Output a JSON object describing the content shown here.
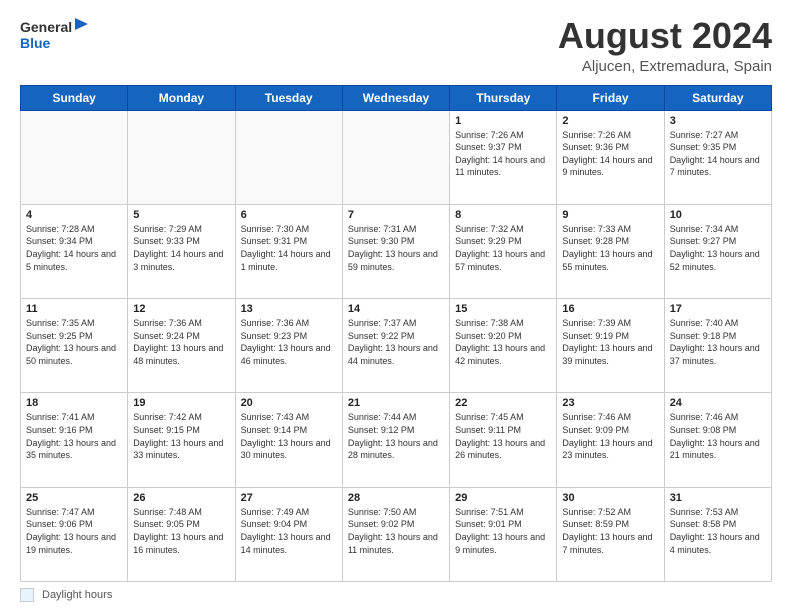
{
  "logo": {
    "line1": "General",
    "line2": "Blue"
  },
  "header": {
    "title": "August 2024",
    "location": "Aljucen, Extremadura, Spain"
  },
  "days_of_week": [
    "Sunday",
    "Monday",
    "Tuesday",
    "Wednesday",
    "Thursday",
    "Friday",
    "Saturday"
  ],
  "weeks": [
    [
      {
        "day": "",
        "info": ""
      },
      {
        "day": "",
        "info": ""
      },
      {
        "day": "",
        "info": ""
      },
      {
        "day": "",
        "info": ""
      },
      {
        "day": "1",
        "info": "Sunrise: 7:26 AM\nSunset: 9:37 PM\nDaylight: 14 hours and 11 minutes."
      },
      {
        "day": "2",
        "info": "Sunrise: 7:26 AM\nSunset: 9:36 PM\nDaylight: 14 hours and 9 minutes."
      },
      {
        "day": "3",
        "info": "Sunrise: 7:27 AM\nSunset: 9:35 PM\nDaylight: 14 hours and 7 minutes."
      }
    ],
    [
      {
        "day": "4",
        "info": "Sunrise: 7:28 AM\nSunset: 9:34 PM\nDaylight: 14 hours and 5 minutes."
      },
      {
        "day": "5",
        "info": "Sunrise: 7:29 AM\nSunset: 9:33 PM\nDaylight: 14 hours and 3 minutes."
      },
      {
        "day": "6",
        "info": "Sunrise: 7:30 AM\nSunset: 9:31 PM\nDaylight: 14 hours and 1 minute."
      },
      {
        "day": "7",
        "info": "Sunrise: 7:31 AM\nSunset: 9:30 PM\nDaylight: 13 hours and 59 minutes."
      },
      {
        "day": "8",
        "info": "Sunrise: 7:32 AM\nSunset: 9:29 PM\nDaylight: 13 hours and 57 minutes."
      },
      {
        "day": "9",
        "info": "Sunrise: 7:33 AM\nSunset: 9:28 PM\nDaylight: 13 hours and 55 minutes."
      },
      {
        "day": "10",
        "info": "Sunrise: 7:34 AM\nSunset: 9:27 PM\nDaylight: 13 hours and 52 minutes."
      }
    ],
    [
      {
        "day": "11",
        "info": "Sunrise: 7:35 AM\nSunset: 9:25 PM\nDaylight: 13 hours and 50 minutes."
      },
      {
        "day": "12",
        "info": "Sunrise: 7:36 AM\nSunset: 9:24 PM\nDaylight: 13 hours and 48 minutes."
      },
      {
        "day": "13",
        "info": "Sunrise: 7:36 AM\nSunset: 9:23 PM\nDaylight: 13 hours and 46 minutes."
      },
      {
        "day": "14",
        "info": "Sunrise: 7:37 AM\nSunset: 9:22 PM\nDaylight: 13 hours and 44 minutes."
      },
      {
        "day": "15",
        "info": "Sunrise: 7:38 AM\nSunset: 9:20 PM\nDaylight: 13 hours and 42 minutes."
      },
      {
        "day": "16",
        "info": "Sunrise: 7:39 AM\nSunset: 9:19 PM\nDaylight: 13 hours and 39 minutes."
      },
      {
        "day": "17",
        "info": "Sunrise: 7:40 AM\nSunset: 9:18 PM\nDaylight: 13 hours and 37 minutes."
      }
    ],
    [
      {
        "day": "18",
        "info": "Sunrise: 7:41 AM\nSunset: 9:16 PM\nDaylight: 13 hours and 35 minutes."
      },
      {
        "day": "19",
        "info": "Sunrise: 7:42 AM\nSunset: 9:15 PM\nDaylight: 13 hours and 33 minutes."
      },
      {
        "day": "20",
        "info": "Sunrise: 7:43 AM\nSunset: 9:14 PM\nDaylight: 13 hours and 30 minutes."
      },
      {
        "day": "21",
        "info": "Sunrise: 7:44 AM\nSunset: 9:12 PM\nDaylight: 13 hours and 28 minutes."
      },
      {
        "day": "22",
        "info": "Sunrise: 7:45 AM\nSunset: 9:11 PM\nDaylight: 13 hours and 26 minutes."
      },
      {
        "day": "23",
        "info": "Sunrise: 7:46 AM\nSunset: 9:09 PM\nDaylight: 13 hours and 23 minutes."
      },
      {
        "day": "24",
        "info": "Sunrise: 7:46 AM\nSunset: 9:08 PM\nDaylight: 13 hours and 21 minutes."
      }
    ],
    [
      {
        "day": "25",
        "info": "Sunrise: 7:47 AM\nSunset: 9:06 PM\nDaylight: 13 hours and 19 minutes."
      },
      {
        "day": "26",
        "info": "Sunrise: 7:48 AM\nSunset: 9:05 PM\nDaylight: 13 hours and 16 minutes."
      },
      {
        "day": "27",
        "info": "Sunrise: 7:49 AM\nSunset: 9:04 PM\nDaylight: 13 hours and 14 minutes."
      },
      {
        "day": "28",
        "info": "Sunrise: 7:50 AM\nSunset: 9:02 PM\nDaylight: 13 hours and 11 minutes."
      },
      {
        "day": "29",
        "info": "Sunrise: 7:51 AM\nSunset: 9:01 PM\nDaylight: 13 hours and 9 minutes."
      },
      {
        "day": "30",
        "info": "Sunrise: 7:52 AM\nSunset: 8:59 PM\nDaylight: 13 hours and 7 minutes."
      },
      {
        "day": "31",
        "info": "Sunrise: 7:53 AM\nSunset: 8:58 PM\nDaylight: 13 hours and 4 minutes."
      }
    ]
  ],
  "footer": {
    "label": "Daylight hours"
  }
}
